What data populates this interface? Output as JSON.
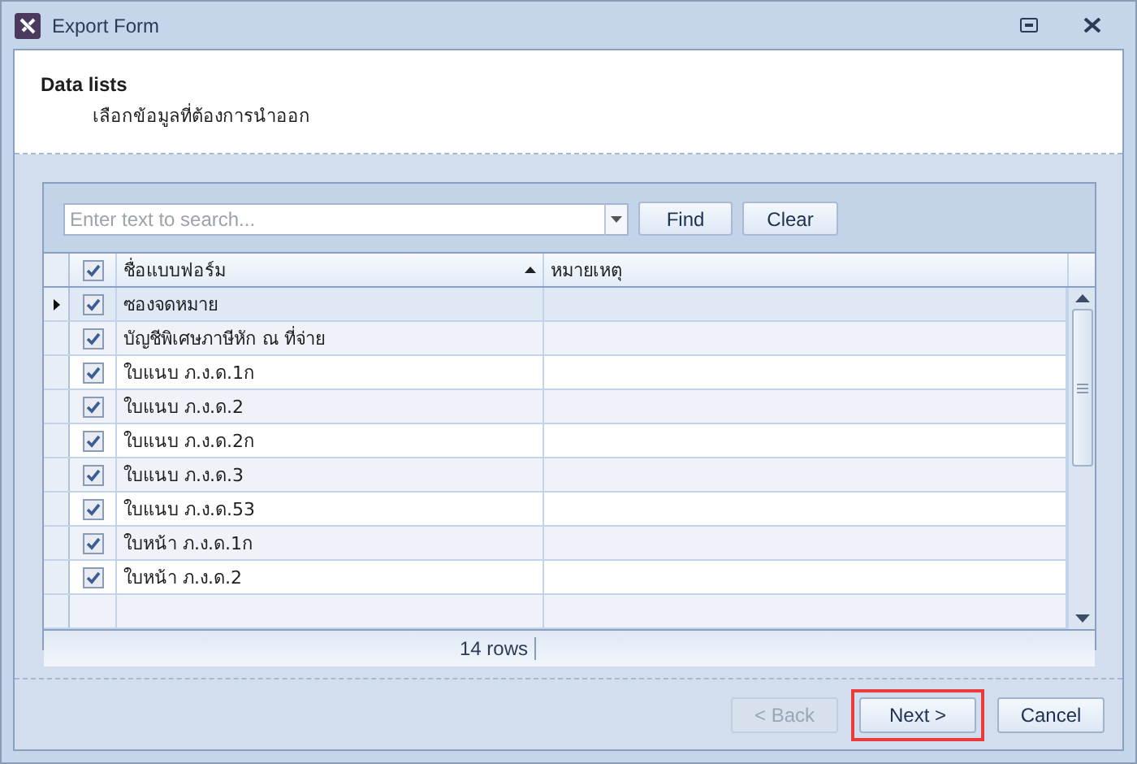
{
  "window": {
    "title": "Export Form"
  },
  "header": {
    "title": "Data lists",
    "subtitle": "เลือกข้อมูลที่ต้องการนำออก"
  },
  "search": {
    "placeholder": "Enter text to search...",
    "buttons": [
      "Find",
      "Clear"
    ]
  },
  "table": {
    "all_checked": true,
    "columns": [
      {
        "label": "ชื่อแบบฟอร์ม",
        "sorted": true
      },
      {
        "label": "หมายเหตุ",
        "sorted": false
      }
    ],
    "rows": [
      {
        "name": "ซองจดหมาย",
        "checked": true,
        "selected": true
      },
      {
        "name": "บัญชีพิเศษภาษีหัก ณ ที่จ่าย",
        "checked": true,
        "selected": false
      },
      {
        "name": "ใบแนบ ภ.ง.ด.1ก",
        "checked": true,
        "selected": false
      },
      {
        "name": "ใบแนบ ภ.ง.ด.2",
        "checked": true,
        "selected": false
      },
      {
        "name": "ใบแนบ ภ.ง.ด.2ก",
        "checked": true,
        "selected": false
      },
      {
        "name": "ใบแนบ ภ.ง.ด.3",
        "checked": true,
        "selected": false
      },
      {
        "name": "ใบแนบ ภ.ง.ด.53",
        "checked": true,
        "selected": false
      },
      {
        "name": "ใบหน้า ภ.ง.ด.1ก",
        "checked": true,
        "selected": false
      },
      {
        "name": "ใบหน้า ภ.ง.ด.2",
        "checked": true,
        "selected": false
      }
    ],
    "footer": "14 rows"
  },
  "buttons": [
    {
      "label": "< Back",
      "disabled": true,
      "highlighted": false
    },
    {
      "label": "Next >",
      "disabled": false,
      "highlighted": true
    },
    {
      "label": "Cancel",
      "disabled": false,
      "highlighted": false
    }
  ]
}
